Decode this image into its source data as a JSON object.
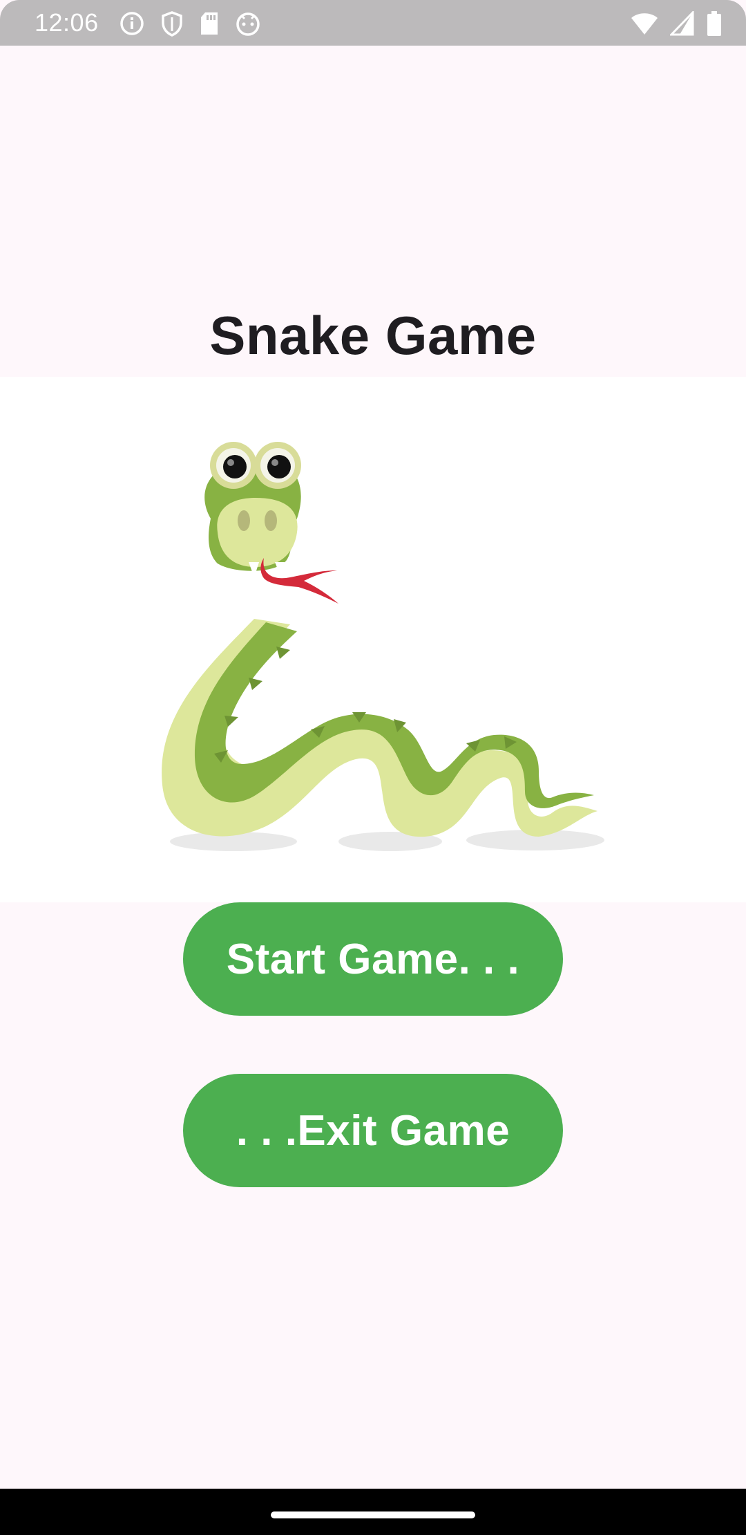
{
  "status_bar": {
    "time": "12:06",
    "left_icons": [
      "info-icon",
      "shield-icon",
      "sd-card-icon",
      "android-face-icon"
    ],
    "right_icons": [
      "wifi-icon",
      "cellular-signal-icon",
      "battery-icon"
    ]
  },
  "screen": {
    "title": "Snake Game",
    "image": "snake-illustration",
    "start_button_label": "Start Game. . .",
    "exit_button_label": ". . .Exit Game"
  },
  "colors": {
    "background": "#fef7fb",
    "button": "#4caf50",
    "button_text": "#ffffff",
    "title_text": "#1f1d21",
    "status_bar": "#bcbabb"
  },
  "navigation_bar": {
    "handle": "home-gesture-handle"
  }
}
